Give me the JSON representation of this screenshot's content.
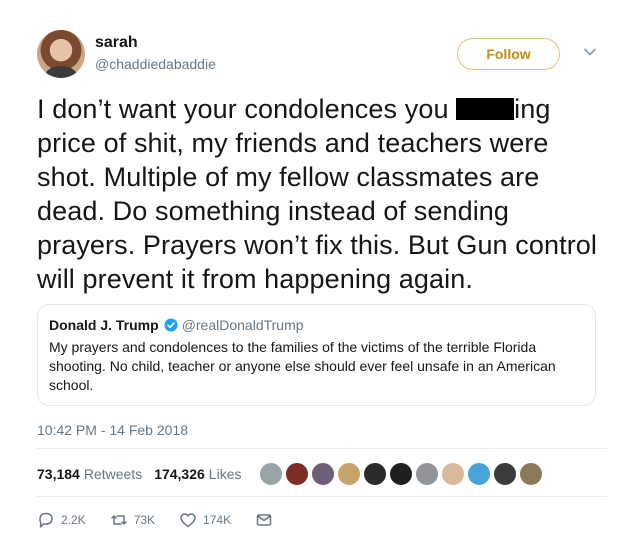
{
  "author": {
    "name": "sarah",
    "handle": "@chaddiedabaddie",
    "follow_label": "Follow"
  },
  "tweet": {
    "text_before": "I don’t want your condolences you ",
    "text_after": "ing price of shit, my friends and teachers were shot. Multiple of my fellow classmates are dead. Do something instead of sending prayers. Prayers won’t fix this. But Gun control will prevent it from happening again."
  },
  "quoted_tweet": {
    "name": "Donald J. Trump",
    "handle": "@realDonaldTrump",
    "text": "My prayers and condolences to the families of the victims of the terrible Florida shooting. No child, teacher or anyone else should ever feel unsafe in an American school."
  },
  "timestamp": "10:42 PM - 14 Feb 2018",
  "stats": {
    "retweets_count": "73,184",
    "retweets_label": "Retweets",
    "likes_count": "174,326",
    "likes_label": "Likes"
  },
  "actions": {
    "reply_count": "2.2K",
    "retweet_count": "73K",
    "like_count": "174K"
  },
  "colors": {
    "follow_accent": "#c28e0e",
    "secondary_text": "#657786",
    "verified": "#1da1f2"
  },
  "icons": [
    "chevron-down-icon",
    "verified-badge-icon",
    "reply-icon",
    "retweet-icon",
    "heart-icon",
    "message-icon"
  ]
}
